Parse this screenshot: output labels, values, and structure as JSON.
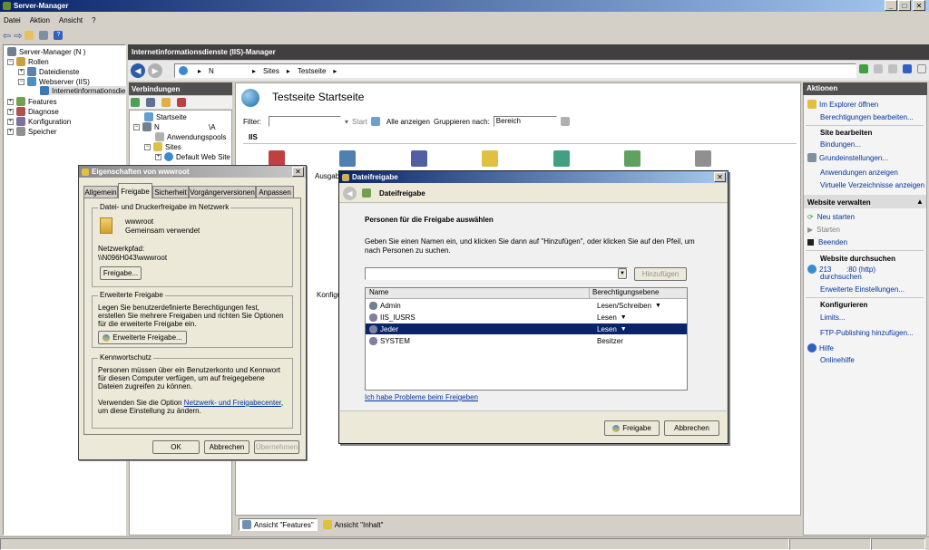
{
  "window": {
    "title": "Server-Manager"
  },
  "menu": [
    "Datei",
    "Aktion",
    "Ansicht",
    "?"
  ],
  "tree": {
    "root": "Server-Manager (N          )",
    "items": [
      "Rollen",
      "Dateidienste",
      "Webserver (IIS)",
      "Internetinformationsdie",
      "Features",
      "Diagnose",
      "Konfiguration",
      "Speicher"
    ]
  },
  "iis": {
    "header": "Internetinformationsdienste (IIS)-Manager",
    "address": [
      "N",
      "Sites",
      "Testseite"
    ],
    "connections_title": "Verbindungen",
    "conn_tree": [
      "Startseite",
      "N",
      "\\A",
      "Anwendungspools",
      "Sites",
      "Default Web Site"
    ],
    "page_title": "Testseite Startseite",
    "filter_label": "Filter:",
    "start_label": "Start",
    "show_all": "Alle anzeigen",
    "group_by": "Gruppieren nach:",
    "group_value": "Bereich",
    "section": "IIS",
    "partial_label1": "Ausgab",
    "partial_label2": "Konfigu",
    "view_features": "Ansicht \"Features\"",
    "view_content": "Ansicht \"Inhalt\""
  },
  "actions": {
    "title": "Aktionen",
    "items1": [
      "Im Explorer öffnen",
      "Berechtigungen bearbeiten..."
    ],
    "site_edit_title": "Site bearbeiten",
    "items2": [
      "Bindungen...",
      "Grundeinstellungen...",
      "Anwendungen anzeigen",
      "Virtuelle Verzeichnisse anzeigen"
    ],
    "manage_title": "Website verwalten",
    "items3": [
      "Neu starten",
      "Starten",
      "Beenden"
    ],
    "browse_title": "Website durchsuchen",
    "browse_lines": [
      "213",
      ":80 (http)",
      "durchsuchen"
    ],
    "advanced": "Erweiterte Einstellungen...",
    "config_title": "Konfigurieren",
    "limits": "Limits...",
    "ftp": "FTP-Publishing hinzufügen...",
    "help": "Hilfe",
    "online_help": "Onlinehilfe"
  },
  "props": {
    "title": "Eigenschaften von wwwroot",
    "tabs": [
      "Allgemein",
      "Freigabe",
      "Sicherheit",
      "Vorgängerversionen",
      "Anpassen"
    ],
    "g1_title": "Datei- und Druckerfreigabe im Netzwerk",
    "folder_name": "wwwroot",
    "folder_state": "Gemeinsam verwendet",
    "path_label": "Netzwerkpfad:",
    "path_value": "\\\\N096H043\\wwwroot",
    "share_button": "Freigabe...",
    "g2_title": "Erweiterte Freigabe",
    "g2_text": "Legen Sie benutzerdefinierte Berechtigungen fest, erstellen Sie mehrere Freigaben und richten Sie Optionen für die erweiterte Freigabe ein.",
    "adv_button": "Erweiterte Freigabe...",
    "g3_title": "Kennwortschutz",
    "g3_text": "Personen müssen über ein Benutzerkonto und Kennwort für diesen Computer verfügen, um auf freigegebene Dateien zugreifen zu können.",
    "g3_text2_pre": "Verwenden Sie die Option ",
    "g3_link": "Netzwerk- und Freigabecenter",
    "g3_text2_post": ", um diese Einstellung zu ändern.",
    "ok": "OK",
    "cancel": "Abbrechen",
    "apply": "Übernehmen"
  },
  "share": {
    "title": "Dateifreigabe",
    "header": "Dateifreigabe",
    "heading": "Personen für die Freigabe auswählen",
    "instructions": "Geben Sie einen Namen ein, und klicken Sie dann auf \"Hinzufügen\", oder klicken Sie auf den Pfeil, um nach Personen zu suchen.",
    "add_button": "Hinzufügen",
    "col_name": "Name",
    "col_level": "Berechtigungsebene",
    "rows": [
      {
        "name": "Admin",
        "level": "Lesen/Schreiben",
        "arrow": "▼"
      },
      {
        "name": "IIS_IUSRS",
        "level": "Lesen",
        "arrow": "▼"
      },
      {
        "name": "Jeder",
        "level": "Lesen",
        "arrow": "▼"
      },
      {
        "name": "SYSTEM",
        "level": "Besitzer",
        "arrow": ""
      }
    ],
    "problem_link": "Ich habe Probleme beim Freigeben",
    "share_button": "Freigabe",
    "cancel_button": "Abbrechen"
  }
}
